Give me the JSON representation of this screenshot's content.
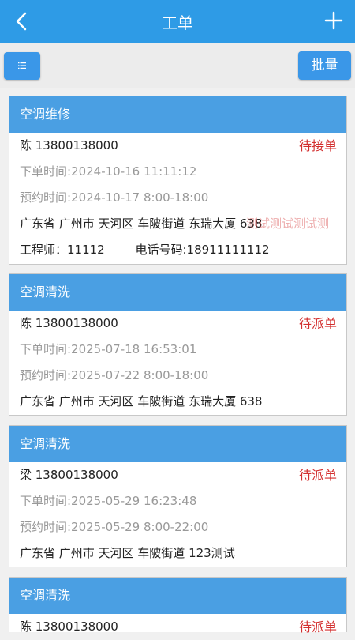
{
  "header": {
    "title": "工单"
  },
  "toolbar": {
    "batch_label": "批量"
  },
  "orders": [
    {
      "service": "空调维修",
      "customer": "陈 13800138000",
      "status": "待接单",
      "order_time": "下单时间:2024-10-16 11:11:12",
      "appointment_time": "预约时间:2024-10-17   8:00-18:00",
      "address": "广东省 广州市 天河区 车陂街道 东瑞大厦 638",
      "note": "测试测试测试测",
      "engineer": "工程师：11112",
      "phone": "电话号码:18911111112"
    },
    {
      "service": "空调清洗",
      "customer": "陈 13800138000",
      "status": "待派单",
      "order_time": "下单时间:2025-07-18 16:53:01",
      "appointment_time": "预约时间:2025-07-22   8:00-18:00",
      "address": "广东省 广州市 天河区 车陂街道 东瑞大厦 638"
    },
    {
      "service": "空调清洗",
      "customer": "梁 13800138000",
      "status": "待派单",
      "order_time": "下单时间:2025-05-29 16:23:48",
      "appointment_time": "预约时间:2025-05-29   8:00-22:00",
      "address": "广东省 广州市 天河区 车陂街道 123测试"
    },
    {
      "service": "空调清洗",
      "customer": "陈 13800138000",
      "status": "待派单"
    }
  ]
}
